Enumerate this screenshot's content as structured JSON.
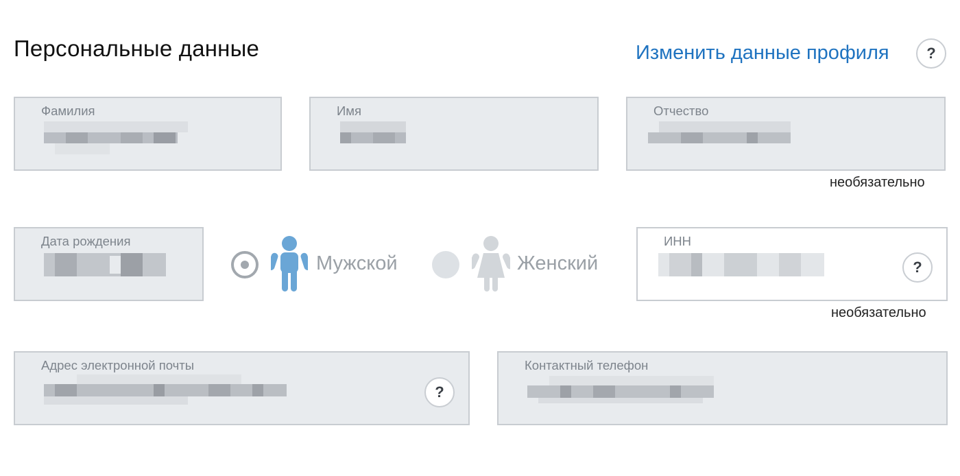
{
  "header": {
    "title": "Персональные данные",
    "edit_link": "Изменить данные профиля",
    "help_icon": "?"
  },
  "fields": {
    "last_name": {
      "label": "Фамилия"
    },
    "first_name": {
      "label": "Имя"
    },
    "middle_name": {
      "label": "Отчество",
      "note": "необязательно"
    },
    "birth_date": {
      "label": "Дата рождения"
    },
    "inn": {
      "label": "ИНН",
      "note": "необязательно",
      "help_icon": "?"
    },
    "email": {
      "label": "Адрес электронной почты",
      "help_icon": "?"
    },
    "phone": {
      "label": "Контактный телефон"
    }
  },
  "gender": {
    "male_label": "Мужской",
    "female_label": "Женский",
    "selected": "male"
  },
  "colors": {
    "link": "#1f73c0",
    "male_icon": "#6aa6d6",
    "female_icon": "#d2d6da",
    "field_bg": "#e8ebee",
    "field_border": "#c8ccd1"
  }
}
